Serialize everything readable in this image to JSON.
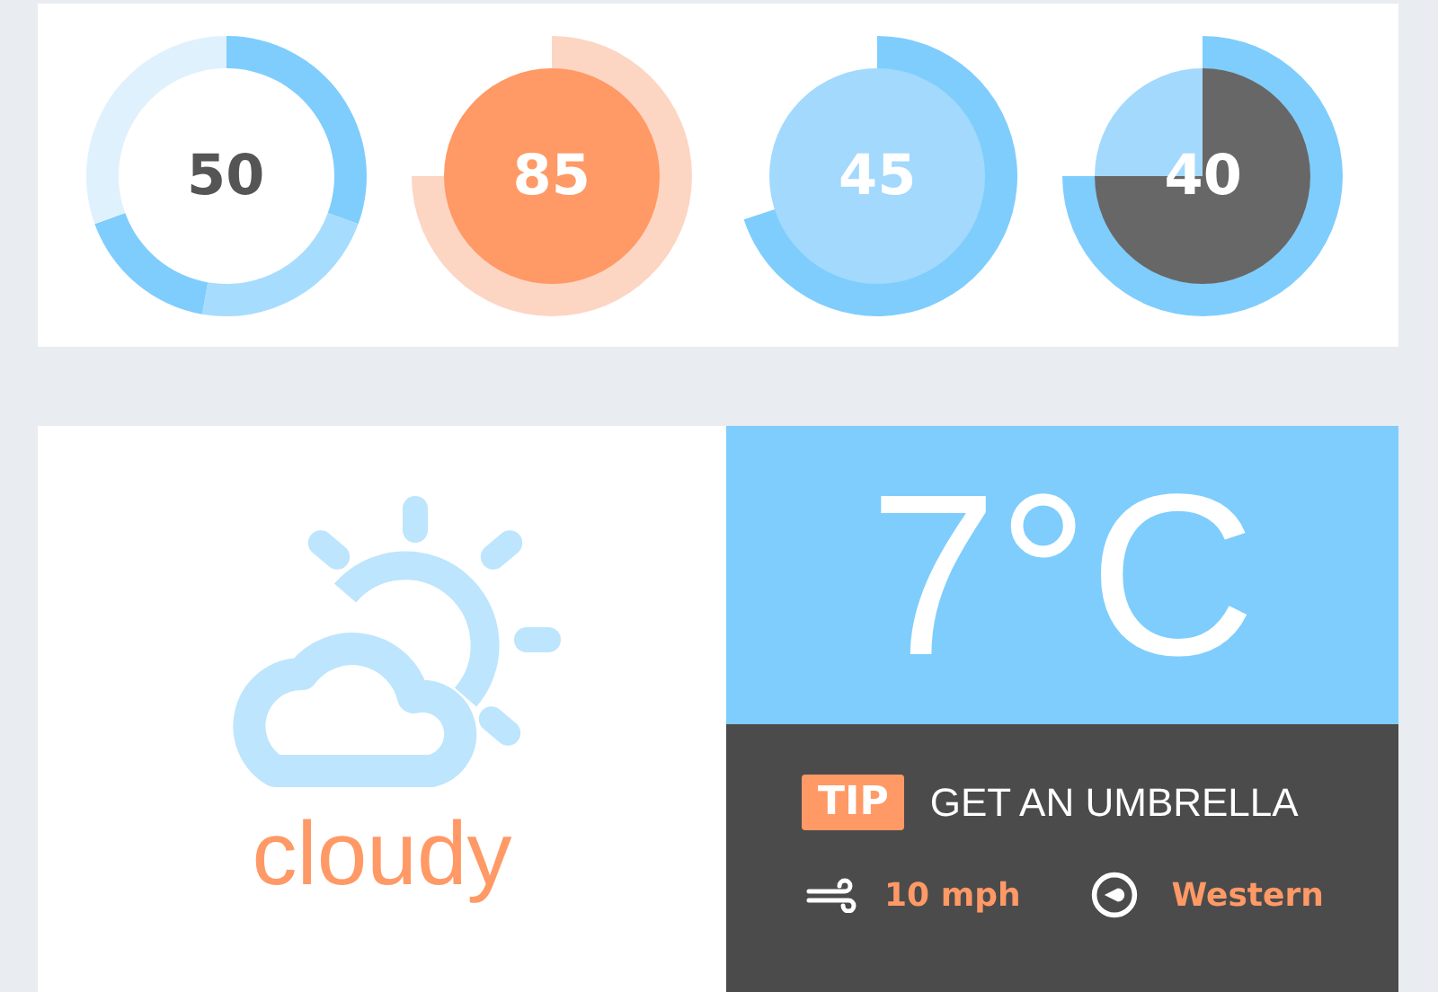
{
  "gauges": [
    {
      "kind": "segmented",
      "value": "50"
    },
    {
      "kind": "warm",
      "value": "85"
    },
    {
      "kind": "cool",
      "value": "45"
    },
    {
      "kind": "pie",
      "value": "40"
    }
  ],
  "weather": {
    "condition": "cloudy",
    "temperature": "7°C",
    "tip": {
      "label": "TIP",
      "text": "GET AN UMBRELLA"
    },
    "wind": {
      "speed": "10 mph",
      "direction": "Western"
    }
  }
}
